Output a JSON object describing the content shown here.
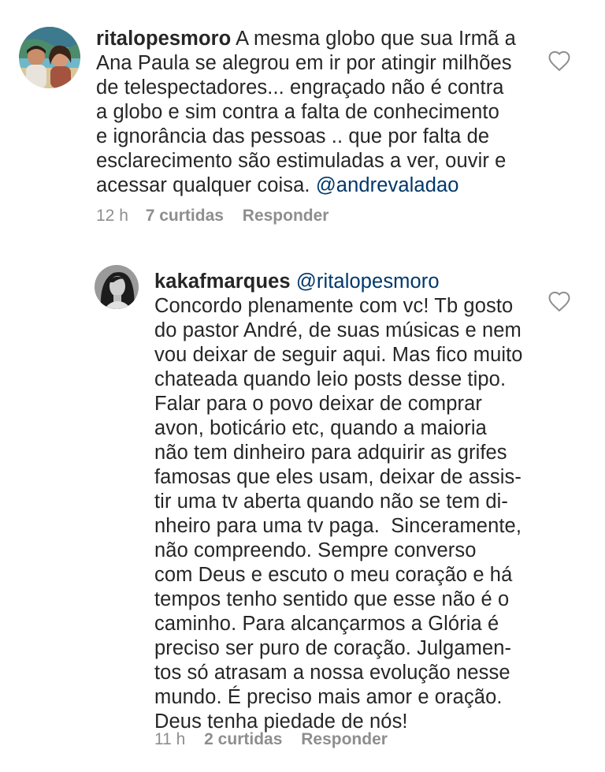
{
  "comments": [
    {
      "username": "ritalopesmoro",
      "lines": [
        "A mesma globo que sua Irmã a",
        "Ana Paula se alegrou em ir por atingir milhões",
        "de telespectadores... engraçado não é contra",
        "a globo e sim contra a falta de conhecimento",
        "e ignorância das pessoas .. que por falta de",
        "esclarecimento são estimuladas a ver, ouvir e",
        "acessar qualquer coisa."
      ],
      "mention_tail": "@andrevaladao",
      "time": "12 h",
      "likes": "7 curtidas",
      "reply": "Responder",
      "avatar_icon": "couple-photo-avatar",
      "like_icon": "heart-outline-icon"
    },
    {
      "username": "kakafmarques",
      "mention_head": "@ritalopesmoro",
      "lines": [
        "Concordo plenamente com vc! Tb gosto",
        "do pastor André, de suas músicas e nem",
        "vou deixar de seguir aqui. Mas fico muito",
        "chateada quando leio posts desse tipo.",
        "Falar para o povo deixar de comprar",
        "avon, boticário etc, quando a maioria",
        "não tem dinheiro para adquirir as grifes",
        "famosas que eles usam, deixar de assis-",
        "tir uma tv aberta quando não se tem di-",
        "nheiro para uma tv paga.  Sinceramente,",
        "não compreendo. Sempre converso",
        "com Deus e escuto o meu coração e há",
        "tempos tenho sentido que esse não é o",
        "caminho. Para alcançarmos a Glória é",
        "preciso ser puro de coração. Julgamen-",
        "tos só atrasam a nossa evolução nesse",
        "mundo. É preciso mais amor e oração.",
        "Deus tenha piedade de nós!"
      ],
      "time": "11 h",
      "likes": "2 curtidas",
      "reply": "Responder",
      "avatar_icon": "woman-portrait-avatar",
      "like_icon": "heart-outline-icon"
    }
  ],
  "colors": {
    "text": "#262626",
    "mention": "#00376b",
    "meta": "#8e8e8e"
  }
}
